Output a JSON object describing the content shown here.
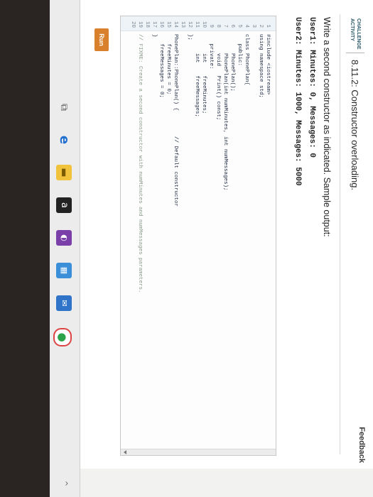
{
  "header": {
    "feedback_label": "Feedback",
    "badge_line1": "CHALLENGE",
    "badge_line2": "ACTIVITY",
    "title": "8.11.2: Constructor overloading."
  },
  "prompt": {
    "instruction": "Write a second constructor as indicated. Sample output:",
    "sample_output": [
      "User1: Minutes: 0, Messages: 0",
      "User2: Minutes: 1000, Messages: 5000"
    ]
  },
  "editor": {
    "lines": [
      {
        "n": "1",
        "code": "#include <iostream>"
      },
      {
        "n": "2",
        "code": "using namespace std;"
      },
      {
        "n": "3",
        "code": ""
      },
      {
        "n": "4",
        "code": "class PhonePlan{"
      },
      {
        "n": "5",
        "code": "   public:"
      },
      {
        "n": "6",
        "code": "      PhonePlan();"
      },
      {
        "n": "7",
        "code": "      PhonePlan(int numMinutes, int numMessages);"
      },
      {
        "n": "8",
        "code": "      void   Print() const;"
      },
      {
        "n": "9",
        "code": "   private:"
      },
      {
        "n": "10",
        "code": "      int    freeMinutes;"
      },
      {
        "n": "11",
        "code": "      int    freeMessages;"
      },
      {
        "n": "12",
        "code": "};"
      },
      {
        "n": "13",
        "code": ""
      },
      {
        "n": "14",
        "code": "PhonePlan::PhonePlan() {        // Default constructor"
      },
      {
        "n": "15",
        "code": "   freeMinutes = 0;"
      },
      {
        "n": "16",
        "code": "   freeMessages = 0;"
      },
      {
        "n": "17",
        "code": "}"
      },
      {
        "n": "18",
        "code": ""
      },
      {
        "n": "19",
        "code": "// FIXME: Create a second constructor with numMinutes and numMessages parameters."
      },
      {
        "n": "20",
        "code": ""
      }
    ]
  },
  "actions": {
    "run_label": "Run"
  },
  "taskbar": {
    "icons": [
      "task-view-icon",
      "edge-icon",
      "file-explorer-icon",
      "amazon-icon",
      "onenote-icon",
      "store-icon",
      "mail-icon",
      "chrome-icon"
    ],
    "notify_label": "^"
  },
  "colors": {
    "run_button": "#d9802d",
    "badge_text": "#2b5a6b",
    "keyword": "#2c4fb3"
  }
}
